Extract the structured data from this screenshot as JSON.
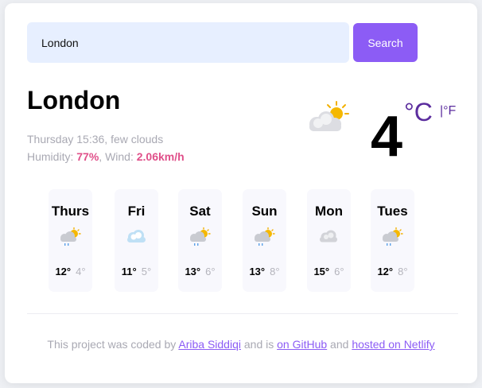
{
  "search": {
    "value": "London",
    "button_label": "Search"
  },
  "current": {
    "city": "London",
    "day_time": "Thursday 15:36",
    "description": "few clouds",
    "humidity_label": "Humidity:",
    "humidity": "77%",
    "wind_label": "Wind:",
    "wind": "2.06km/h",
    "temperature": "4",
    "unit_celsius": "°C",
    "unit_separator": "|°F",
    "icon": "few-clouds-icon"
  },
  "forecast": [
    {
      "day": "Thurs",
      "max": "12°",
      "min": "4°",
      "icon": "sun-cloud-rain-icon"
    },
    {
      "day": "Fri",
      "max": "11°",
      "min": "5°",
      "icon": "snow-cloud-icon"
    },
    {
      "day": "Sat",
      "max": "13°",
      "min": "6°",
      "icon": "sun-cloud-rain-icon"
    },
    {
      "day": "Sun",
      "max": "13°",
      "min": "8°",
      "icon": "sun-cloud-rain-icon"
    },
    {
      "day": "Mon",
      "max": "15°",
      "min": "6°",
      "icon": "cloud-icon"
    },
    {
      "day": "Tues",
      "max": "12°",
      "min": "8°",
      "icon": "sun-cloud-rain-icon"
    }
  ],
  "footer": {
    "prefix": "This project was coded by ",
    "author_link": "Ariba Siddiqi",
    "middle": " and is ",
    "github_link": "on GitHub",
    "and": " and ",
    "netlify_link": "hosted on Netlify"
  },
  "colors": {
    "accent": "#8c5cf5",
    "highlight": "#e0508a",
    "unit": "#5b2d9e",
    "input_bg": "#e7efff"
  }
}
